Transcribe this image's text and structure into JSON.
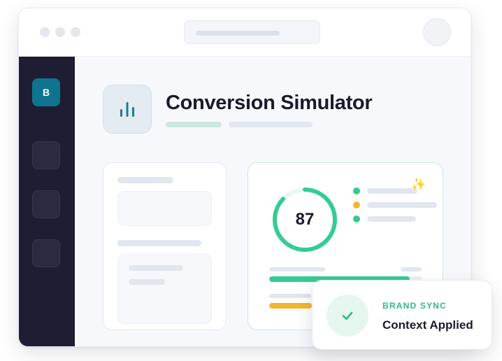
{
  "app": {
    "brand_initial": "B",
    "title": "Conversion Simulator"
  },
  "score": {
    "value": "87",
    "progress": 0.87,
    "ring_color": "#34cc94"
  },
  "metrics": {
    "legend": [
      {
        "color": "#34cc94"
      },
      {
        "color": "#f4b72c"
      },
      {
        "color": "#34cc94"
      }
    ],
    "bars": [
      {
        "color": "#34cc94",
        "fill": 0.92
      },
      {
        "color": "#f4b72c",
        "fill": 0.28
      }
    ]
  },
  "toast": {
    "eyebrow": "BRAND SYNC",
    "title": "Context Applied",
    "icon": "check-icon",
    "accent": "#2bb98a"
  },
  "colors": {
    "sidebar": "#1e1d33",
    "brand": "#0f7490",
    "accent_green": "#34cc94",
    "accent_yellow": "#f4b72c"
  }
}
